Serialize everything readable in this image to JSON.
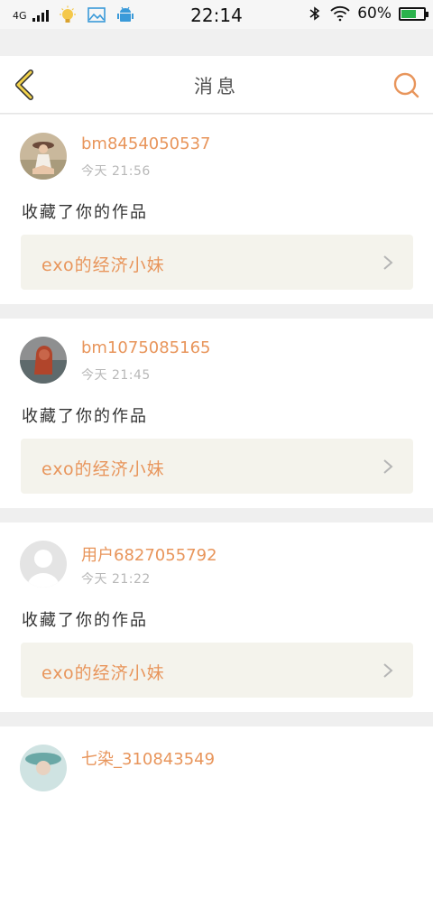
{
  "status_bar": {
    "network": "4G",
    "time": "22:14",
    "battery_text": "60%",
    "battery_level": 0.6,
    "battery_color": "#2bb24c"
  },
  "header": {
    "title": "消息",
    "accent_color": "#e8955b"
  },
  "messages": [
    {
      "username": "bm8454050537",
      "time": "今天 21:56",
      "action": "收藏了你的作品",
      "work_title": "exo的经济小妹",
      "avatar": "photo-girl-sitting"
    },
    {
      "username": "bm1075085165",
      "time": "今天 21:45",
      "action": "收藏了你的作品",
      "work_title": "exo的经济小妹",
      "avatar": "photo-red-hair"
    },
    {
      "username": "用户6827055792",
      "time": "今天 21:22",
      "action": "收藏了你的作品",
      "work_title": "exo的经济小妹",
      "avatar": "default-user"
    },
    {
      "username": "七染_310843549",
      "avatar": "photo-teal-hat"
    }
  ]
}
